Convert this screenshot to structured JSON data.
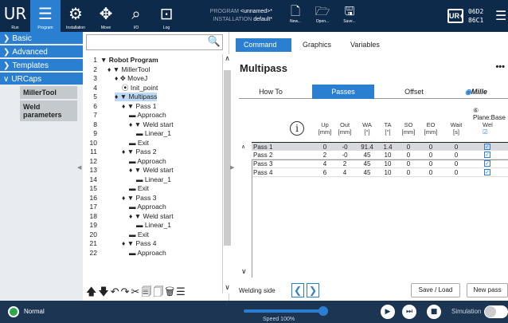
{
  "topbar": {
    "buttons": [
      {
        "label": "Run",
        "glyph": "UR"
      },
      {
        "label": "Program",
        "glyph": "☰"
      },
      {
        "label": "Installation",
        "glyph": "⚙"
      },
      {
        "label": "Move",
        "glyph": "✥"
      },
      {
        "label": "I/O",
        "glyph": "⌕"
      },
      {
        "label": "Log",
        "glyph": "⊡"
      }
    ],
    "program_label": "PROGRAM",
    "program_value": "<unnamed>*",
    "installation_label": "INSTALLATION",
    "installation_value": "default*",
    "file_buttons": [
      {
        "label": "New...",
        "glyph": "🗋"
      },
      {
        "label": "Open...",
        "glyph": "🗁"
      },
      {
        "label": "Save...",
        "glyph": "🖫"
      }
    ],
    "logo": "UR+",
    "serial_line1": "06D2",
    "serial_line2": "86C1",
    "menu_glyph": "☰"
  },
  "leftnav": {
    "items": [
      {
        "label": "Basic",
        "chevron": "❯"
      },
      {
        "label": "Advanced",
        "chevron": "❯"
      },
      {
        "label": "Templates",
        "chevron": "❯"
      },
      {
        "label": "URCaps",
        "chevron": "∨"
      }
    ],
    "sub_items": [
      "MillerTool",
      "Weld parameters"
    ]
  },
  "tree": {
    "search_icon": "🔍",
    "rows": [
      {
        "num": "1",
        "indent": 0,
        "text": "▼ Robot Program",
        "bold": true
      },
      {
        "num": "2",
        "indent": 1,
        "text": "♦ ▼ MillerTool"
      },
      {
        "num": "3",
        "indent": 2,
        "text": "♦ ✥ MoveJ"
      },
      {
        "num": "4",
        "indent": 3,
        "text": "⦿ Init_point"
      },
      {
        "num": "5",
        "indent": 2,
        "text": "♦ ▼ Multipass",
        "selected": true
      },
      {
        "num": "6",
        "indent": 3,
        "text": "♦ ▼ Pass 1"
      },
      {
        "num": "7",
        "indent": 4,
        "text": "▬ Approach"
      },
      {
        "num": "8",
        "indent": 4,
        "text": "♦ ▼ Weld start"
      },
      {
        "num": "9",
        "indent": 5,
        "text": "▬ Linear_1"
      },
      {
        "num": "10",
        "indent": 4,
        "text": "▬ Exit"
      },
      {
        "num": "11",
        "indent": 3,
        "text": "♦ ▼ Pass 2"
      },
      {
        "num": "12",
        "indent": 4,
        "text": "▬ Approach"
      },
      {
        "num": "13",
        "indent": 4,
        "text": "♦ ▼ Weld start"
      },
      {
        "num": "14",
        "indent": 5,
        "text": "▬ Linear_1"
      },
      {
        "num": "15",
        "indent": 4,
        "text": "▬ Exit"
      },
      {
        "num": "16",
        "indent": 3,
        "text": "♦ ▼ Pass 3"
      },
      {
        "num": "17",
        "indent": 4,
        "text": "▬ Approach"
      },
      {
        "num": "18",
        "indent": 4,
        "text": "♦ ▼ Weld start"
      },
      {
        "num": "19",
        "indent": 5,
        "text": "▬ Linear_1"
      },
      {
        "num": "20",
        "indent": 4,
        "text": "▬ Exit"
      },
      {
        "num": "21",
        "indent": 3,
        "text": "♦ ▼ Pass 4"
      },
      {
        "num": "22",
        "indent": 4,
        "text": "▬ Approach"
      }
    ],
    "tools": "🡅🡇↶↷✂🗐🗍🗑☰"
  },
  "panel": {
    "tabs": [
      "Command",
      "Graphics",
      "Variables"
    ],
    "title": "Multipass",
    "more": "•••",
    "subtabs": [
      "How To",
      "Passes",
      "Offset"
    ],
    "brand": "Mille",
    "plane": "⑥ Plane:Base",
    "headers": [
      {
        "l1": "Up",
        "l2": "[mm]"
      },
      {
        "l1": "Out",
        "l2": "[mm]"
      },
      {
        "l1": "WA",
        "l2": "[°]"
      },
      {
        "l1": "TA",
        "l2": "[°]"
      },
      {
        "l1": "SO",
        "l2": "[mm]"
      },
      {
        "l1": "EO",
        "l2": "[mm]"
      },
      {
        "l1": "Wait",
        "l2": "[s]"
      },
      {
        "l1": "Wel",
        "l2": "☑"
      }
    ],
    "rows": [
      {
        "name": "Pass 1",
        "up": "0",
        "out": "-0",
        "wa": "91.4",
        "ta": "1.4",
        "so": "0",
        "eo": "0",
        "wait": "0",
        "checked": true
      },
      {
        "name": "Pass 2",
        "up": "2",
        "out": "-0",
        "wa": "45",
        "ta": "10",
        "so": "0",
        "eo": "0",
        "wait": "0",
        "checked": true
      },
      {
        "name": "Pass 3",
        "up": "4",
        "out": "2",
        "wa": "45",
        "ta": "10",
        "so": "0",
        "eo": "0",
        "wait": "0",
        "checked": true
      },
      {
        "name": "Pass 4",
        "up": "6",
        "out": "4",
        "wa": "45",
        "ta": "10",
        "so": "0",
        "eo": "0",
        "wait": "0",
        "checked": true
      }
    ],
    "welding_side": "Welding side",
    "left_arrow": "❮",
    "right_arrow": "❯",
    "save_load": "Save / Load",
    "new_pass": "New pass"
  },
  "bottombar": {
    "status": "Normal",
    "speed": "Speed 100%",
    "speed_fraction": 1.0,
    "play": "▶",
    "step": "⏭",
    "stop": "■",
    "simulation": "Simulation"
  }
}
